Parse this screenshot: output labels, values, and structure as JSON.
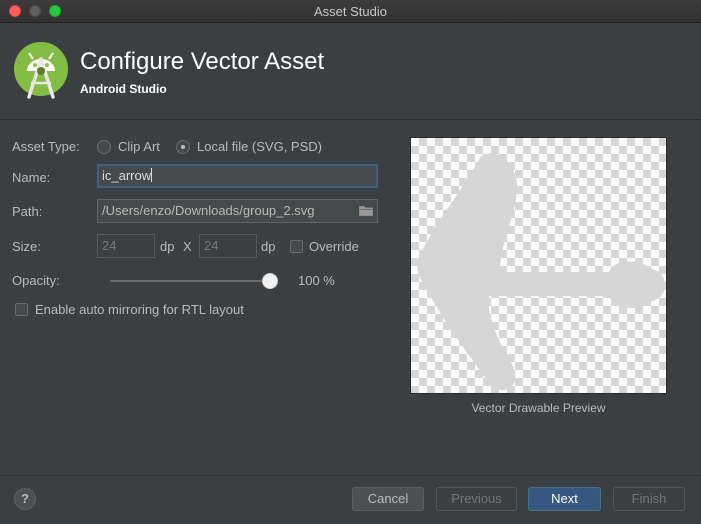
{
  "window": {
    "title": "Asset Studio"
  },
  "header": {
    "title": "Configure Vector Asset",
    "subtitle": "Android Studio",
    "logo": "android-studio-logo"
  },
  "form": {
    "asset_type_label": "Asset Type:",
    "asset_type_options": [
      {
        "label": "Clip Art",
        "selected": false
      },
      {
        "label": "Local file (SVG, PSD)",
        "selected": true
      }
    ],
    "name_label": "Name:",
    "name_value": "ic_arrow",
    "path_label": "Path:",
    "path_value": "/Users/enzo/Downloads/group_2.svg",
    "size_label": "Size:",
    "width_value": "24",
    "height_value": "24",
    "unit": "dp",
    "times": "X",
    "override_label": "Override",
    "override_checked": false,
    "opacity_label": "Opacity:",
    "opacity_value": "100 %",
    "opacity_fraction": 1.0,
    "rtl_label": "Enable auto mirroring for RTL layout",
    "rtl_checked": false
  },
  "preview": {
    "caption": "Vector Drawable Preview"
  },
  "footer": {
    "help_label": "?",
    "cancel": "Cancel",
    "previous": "Previous",
    "next": "Next",
    "finish": "Finish"
  },
  "colors": {
    "accent": "#365880",
    "focus": "#3d6185",
    "android_green": "#a4c639"
  }
}
